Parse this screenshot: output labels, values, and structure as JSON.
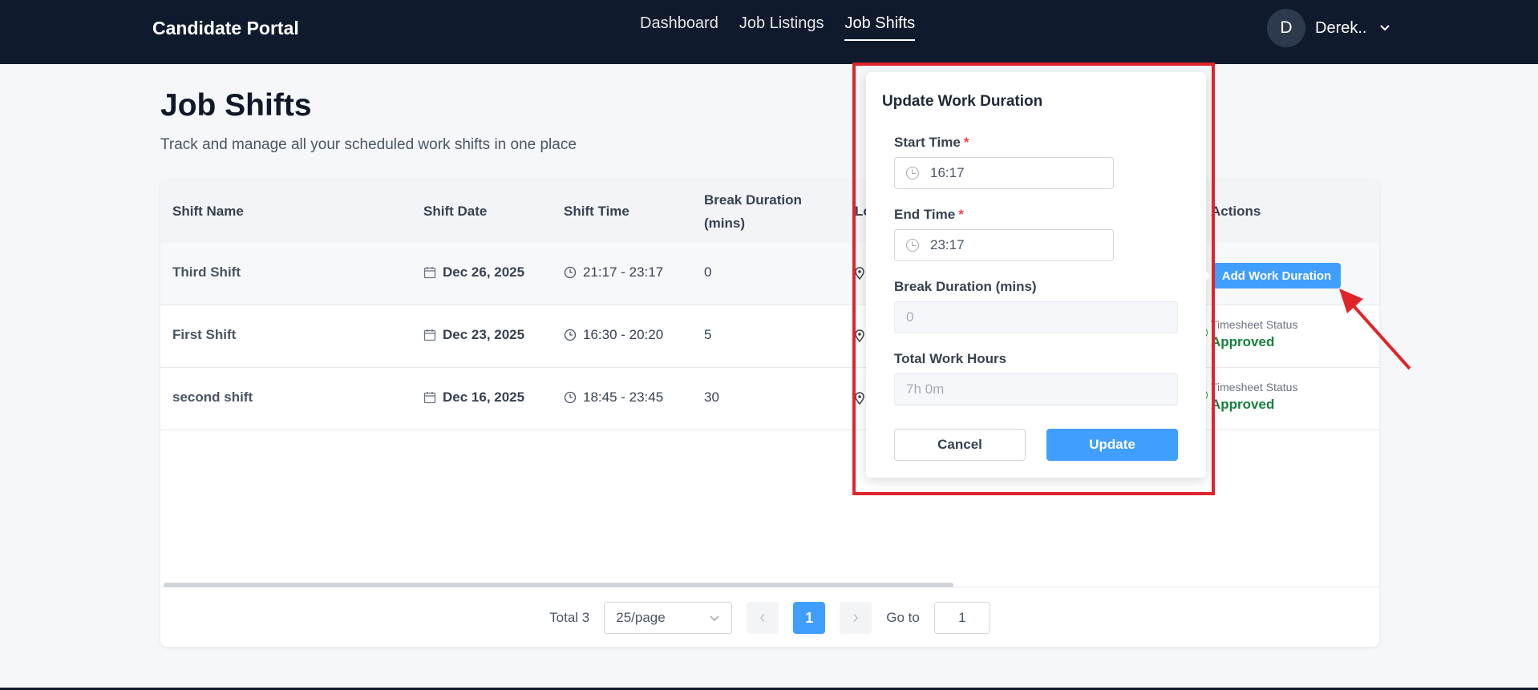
{
  "nav": {
    "brand": "Candidate Portal",
    "links": [
      "Dashboard",
      "Job Listings",
      "Job Shifts"
    ],
    "active": "Job Shifts",
    "user_initial": "D",
    "user_name": "Derek.."
  },
  "page": {
    "title": "Job Shifts",
    "subtitle": "Track and manage all your scheduled work shifts in one place"
  },
  "table": {
    "headers": {
      "shift_name": "Shift Name",
      "shift_date": "Shift Date",
      "shift_time": "Shift Time",
      "break_line1": "Break Duration",
      "break_line2": "(mins)",
      "location_partial": "Lo",
      "actions": "Actions"
    },
    "rows": [
      {
        "name": "Third Shift",
        "date": "Dec 26, 2025",
        "time": "21:17 - 23:17",
        "break": "0"
      },
      {
        "name": "First Shift",
        "date": "Dec 23, 2025",
        "time": "16:30 - 20:20",
        "break": "5"
      },
      {
        "name": "second shift",
        "date": "Dec 16, 2025",
        "time": "18:45 - 23:45",
        "break": "30"
      }
    ],
    "add_work_duration": "Add Work Duration",
    "timesheet_label": "Timesheet Status",
    "timesheet_value": "Approved"
  },
  "pagination": {
    "total": "Total 3",
    "page_size": "25/page",
    "current_page": "1",
    "goto_label": "Go to",
    "goto_value": "1"
  },
  "dialog": {
    "title": "Update Work Duration",
    "start_label": "Start Time",
    "start_value": "16:17",
    "end_label": "End Time",
    "end_value": "23:17",
    "required_mark": "*",
    "break_label": "Break Duration (mins)",
    "break_value": "0",
    "total_label": "Total Work Hours",
    "total_value": "7h 0m",
    "cancel": "Cancel",
    "update": "Update"
  },
  "colors": {
    "nav_bg": "#0f1b2d",
    "primary": "#409eff",
    "approved": "#15803d",
    "highlight": "#e0242b"
  }
}
